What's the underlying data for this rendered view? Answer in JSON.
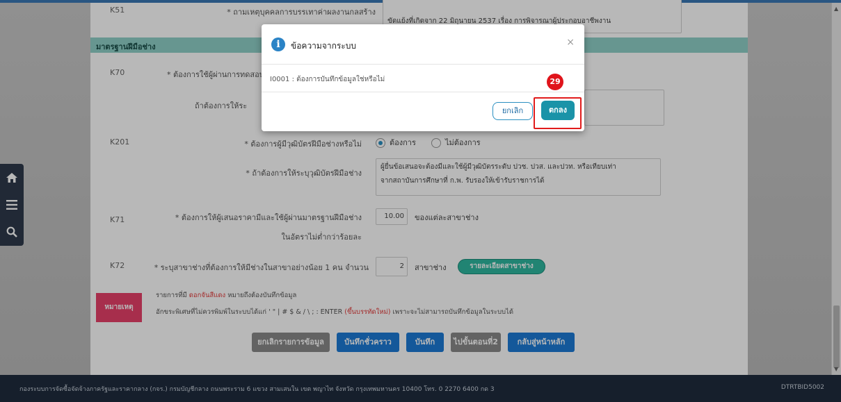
{
  "form": {
    "row_k51": {
      "code": "K51",
      "label": "* ถามเหตุบุคคลการบรรเทาค่าผลงานกลสร้าง",
      "value": "ขัดแย้งที่เกิดจาก 22 มิถุนายน 2537 เรื่อง การพิจารณาผู้ประกอบอาชีพงาน"
    },
    "section_title": "มาตรฐานฝีมือช่าง",
    "row_k70": {
      "code": "K70",
      "label": "* ต้องการใช้ผู้ผ่านการทดสอบ"
    },
    "row_k70_sub": {
      "label": "ถ้าต้องการให้ระ"
    },
    "row_k201": {
      "code": "K201",
      "label": "* ต้องการผู้มีวุฒิบัตรฝีมือช่างหรือไม่",
      "option_yes": "ต้องการ",
      "option_no": "ไม่ต้องการ"
    },
    "row_k201_sub": {
      "label": "* ถ้าต้องการให้ระบุวุฒิบัตรฝีมือช่าง",
      "value_line1": "ผู้ยื่นข้อเสนอจะต้องมีและใช้ผู้มีวุฒิบัตรระดับ ปวช. ปวส. และปวท. หรือเทียบเท่า",
      "value_line2": "จากสถาบันการศึกษาที่ ก.พ. รับรองให้เข้ารับราชการได้"
    },
    "row_k71": {
      "code": "K71",
      "label_line1": "* ต้องการให้ผู้เสนอราคามีและใช้ผู้ผ่านมาตรฐานฝีมือช่าง",
      "label_line2": "ในอัตราไม่ต่ำกว่าร้อยละ",
      "value": "10.00",
      "suffix": "ของแต่ละสาขาช่าง"
    },
    "row_k72": {
      "code": "K72",
      "label": "* ระบุสาขาช่างที่ต้องการให้มีช่างในสาขาอย่างน้อย 1 คน จำนวน",
      "value": "2",
      "suffix": "สาขาช่าง",
      "detail_button": "รายละเอียดสาขาช่าง"
    },
    "note": {
      "tag": "หมายเหตุ",
      "line1_prefix": "รายการที่มี",
      "line1_red": "ดอกจันสีแดง",
      "line1_suffix": "หมายถึงต้องบันทึกข้อมูล",
      "line2_prefix": "อักขระพิเศษที่ไม่ควรพิมพ์ในระบบได้แก่ ' \" | # $ & / \\ ; : ENTER",
      "line2_red": "(ขึ้นบรรทัดใหม่)",
      "line2_suffix": "เพราะจะไม่สามารถบันทึกข้อมูลในระบบได้"
    },
    "actions": {
      "cancel_all": "ยกเลิกรายการข้อมูล",
      "save_draft": "บันทึกชั่วคราว",
      "save": "บันทึก",
      "next_step": "ไปขั้นตอนที่2",
      "back_home": "กลับสู่หน้าหลัก"
    }
  },
  "footer": {
    "text": "กองระบบการจัดซื้อจัดจ้างภาครัฐและราคากลาง (กจร.) กรมบัญชีกลาง ถนนพระราม 6 แขวง สามเสนใน เขต พญาไท จังหวัด กรุงเทพมหานคร 10400 โทร. 0 2270 6400 กด 3",
    "page_code": "DTRTBID5002"
  },
  "modal": {
    "title": "ข้อความจากระบบ",
    "close_glyph": "×",
    "message": "I0001 : ต้องการบันทึกข้อมูลใช่หรือไม่",
    "cancel_label": "ยกเลิก",
    "ok_label": "ตกลง"
  },
  "annotation": {
    "step_number": "29"
  },
  "colors": {
    "section_header": "#8fd0c8",
    "ok_button": "#1a93a8",
    "highlight": "#e11b1b",
    "footer": "#1f2c3e"
  }
}
